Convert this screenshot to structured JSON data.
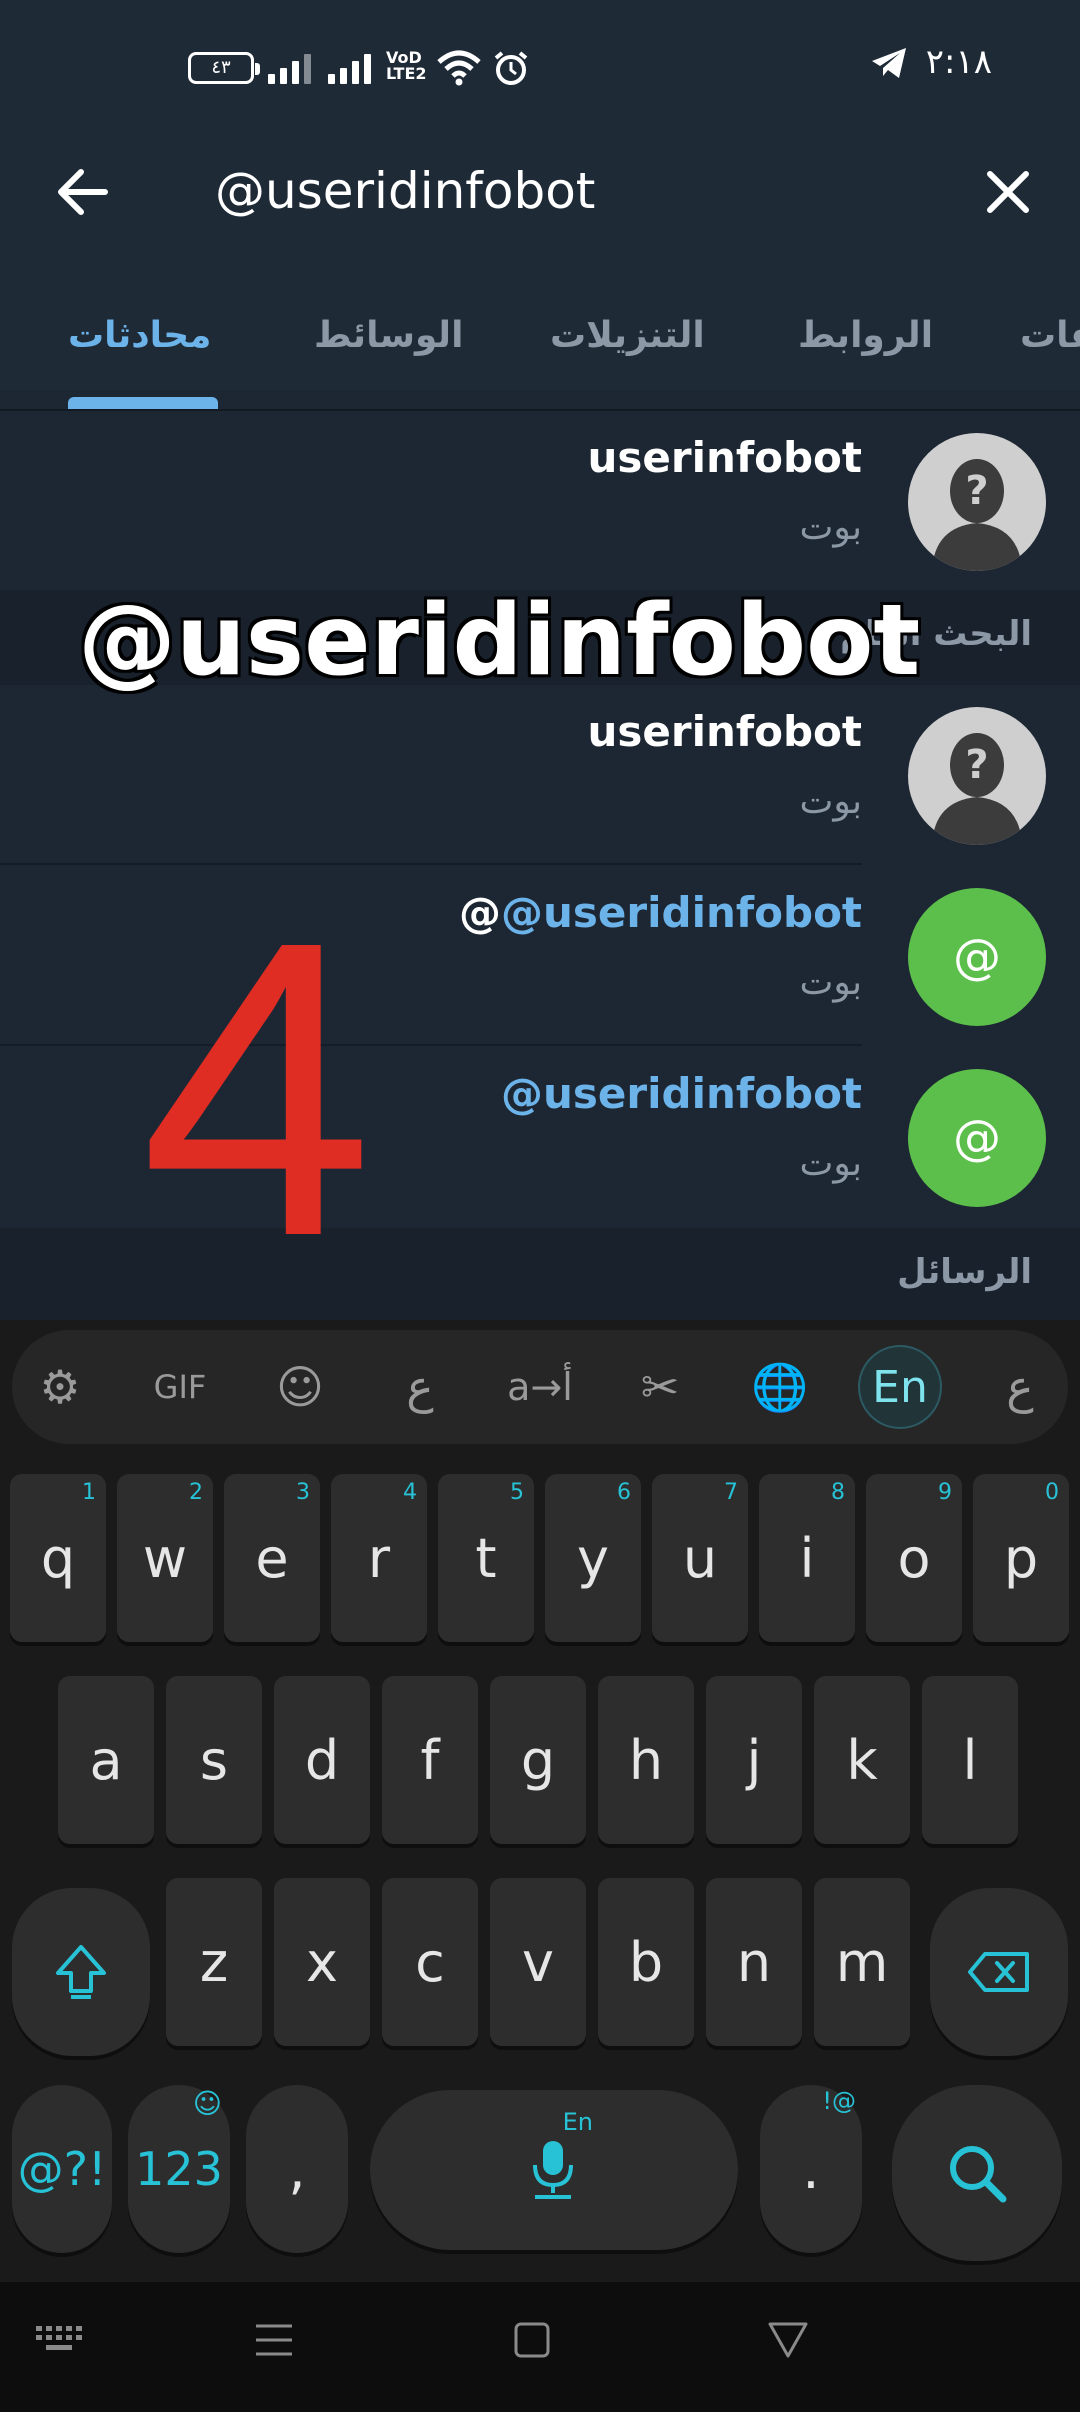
{
  "status_bar": {
    "time": "٢:١٨",
    "battery": "٤٣",
    "network": "VoLTE2",
    "icons": [
      "battery-icon",
      "signal-icon",
      "signal-icon",
      "volte-icon",
      "wifi-icon",
      "alarm-icon",
      "telegram-icon"
    ]
  },
  "search": {
    "query": "@useridinfobot",
    "back_icon": "arrow-left-icon",
    "close_icon": "close-icon"
  },
  "tabs": [
    {
      "label": "محادثات",
      "active": true
    },
    {
      "label": "الوسائط",
      "active": false
    },
    {
      "label": "التنزيلات",
      "active": false
    },
    {
      "label": "الروابط",
      "active": false
    },
    {
      "label": "ملفات",
      "active": false
    }
  ],
  "results": {
    "top": {
      "title": "userinfobot",
      "subtitle": "بوت"
    },
    "section_public": "البحث العام",
    "public": [
      {
        "title": "userinfobot",
        "subtitle": "بوت"
      },
      {
        "title_prefix": "@",
        "title_link": "@useridinfobot",
        "subtitle": "بوت",
        "avatar_letter": "@"
      },
      {
        "title_link": "@useridinfobot",
        "subtitle": "بوت",
        "avatar_letter": "@"
      }
    ],
    "section_messages": "الرسائل"
  },
  "overlay": {
    "caption": "@useridinfobot",
    "step_number": "4"
  },
  "keyboard": {
    "toolbar": [
      "⚙",
      "GIF",
      "☺",
      "ع",
      "a→أ",
      "✂",
      "🌐",
      "En",
      "ع"
    ],
    "row1": [
      {
        "key": "q",
        "num": "1"
      },
      {
        "key": "w",
        "num": "2"
      },
      {
        "key": "e",
        "num": "3"
      },
      {
        "key": "r",
        "num": "4"
      },
      {
        "key": "t",
        "num": "5"
      },
      {
        "key": "y",
        "num": "6"
      },
      {
        "key": "u",
        "num": "7"
      },
      {
        "key": "i",
        "num": "8"
      },
      {
        "key": "o",
        "num": "9"
      },
      {
        "key": "p",
        "num": "0"
      }
    ],
    "row2": [
      "a",
      "s",
      "d",
      "f",
      "g",
      "h",
      "j",
      "k",
      "l"
    ],
    "row3": [
      "z",
      "x",
      "c",
      "v",
      "b",
      "n",
      "m"
    ],
    "symbols": "@?!",
    "numbers": "123",
    "comma": ",",
    "period": ".",
    "period_sup": "!@",
    "space_sup": "En"
  },
  "colors": {
    "accent": "#6cb3ea",
    "background": "#1d2733",
    "keyboard_accent": "#27c2d6",
    "avatar_green": "#5cbf4b",
    "overlay_red": "#e02d24"
  }
}
